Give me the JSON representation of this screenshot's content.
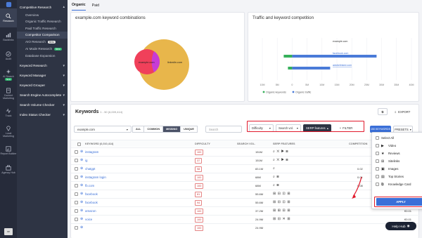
{
  "rail": {
    "items": [
      {
        "icon": "search-icon",
        "label": "Research",
        "active": true
      },
      {
        "icon": "chart-icon",
        "label": "Backlinks"
      },
      {
        "icon": "check-icon",
        "label": "Audit"
      },
      {
        "icon": "ai-icon",
        "label": "AI Search",
        "badge": "New"
      },
      {
        "icon": "doc-icon",
        "label": "Content Marketing"
      },
      {
        "icon": "pulse-icon",
        "label": "Track"
      },
      {
        "icon": "pin-icon",
        "label": "Local Marketing"
      },
      {
        "icon": "report-icon",
        "label": "Report Builder"
      },
      {
        "icon": "agency-icon",
        "label": "Agency Hub"
      }
    ]
  },
  "sidebar": {
    "sections": [
      {
        "label": "Competitive Research",
        "expanded": true,
        "subs": [
          {
            "label": "Overview"
          },
          {
            "label": "Organic Traffic Research"
          },
          {
            "label": "Paid Traffic Research"
          },
          {
            "label": "Competitor Comparison",
            "active": true
          },
          {
            "label": "AIO Research",
            "tag": "Beta"
          },
          {
            "label": "AI Mode Research",
            "tag": "New"
          },
          {
            "label": "Database Expansion"
          }
        ]
      },
      {
        "label": "Keyword Research"
      },
      {
        "label": "Keyword Manager"
      },
      {
        "label": "Keyword Grouper"
      },
      {
        "label": "Search Engine Autocomplete"
      },
      {
        "label": "Search Volume Checker"
      },
      {
        "label": "Index Status Checker"
      }
    ]
  },
  "tabs": [
    {
      "label": "Organic",
      "active": true
    },
    {
      "label": "Paid"
    }
  ],
  "venn": {
    "title": "example.com keyword combinations",
    "labels": {
      "left": "example.com",
      "right": "linkedin.com"
    },
    "colors": {
      "left": "#f0405a",
      "right": "#e8b64b",
      "overlap": "#c73bd6"
    }
  },
  "traffic": {
    "title": "Traffic and keyword competition",
    "rows": [
      {
        "label": "example.com"
      },
      {
        "label": "facebook.com",
        "link": true
      },
      {
        "label": "adobelinked.com",
        "link": true
      }
    ],
    "ticks": [
      "10M",
      "5M",
      "0",
      "5M",
      "10M",
      "15M",
      "20M",
      "25M",
      "30M",
      "35M",
      "40M"
    ],
    "legend": [
      "Organic keywords",
      "Organic traffic"
    ],
    "colors": {
      "organic": "#35b05a",
      "traffic": "#4a7bd8"
    }
  },
  "keywords": {
    "title": "Keywords",
    "count": "1 - 50 (6,009,414)",
    "export": "EXPORT",
    "domain_select": "example.com",
    "filter_tabs": [
      "ALL",
      "COMMON",
      "MISSING",
      "UNIQUE"
    ],
    "active_filter": "MISSING",
    "search_placeholder": "Search",
    "filters": [
      "Difficulty",
      "Search vol.",
      "SERP features"
    ],
    "filter_btn": "FILTER",
    "keywords_btn": "150 KEYWORDS",
    "presets": "PRESETS",
    "columns": [
      "KEYWORD (6,010,414)",
      "DIFFICULTY",
      "SEARCH VOL.",
      "SERP FEATURES",
      "COMPETITION",
      "CPC"
    ],
    "rows": [
      {
        "kw": "instagram",
        "diff": "100",
        "vol": "151M",
        "serp": "⌕ ✕ ▶ ⊞",
        "comp": "",
        "cpc": "€0.01"
      },
      {
        "kw": "ig",
        "diff": "37",
        "vol": "151M",
        "serp": "⌕ ✕ ▶ ⊞",
        "comp": "",
        "cpc": "€0.01"
      },
      {
        "kw": "chatgpt",
        "diff": "98",
        "vol": "83.1M",
        "serp": "⌕",
        "comp": "0.02",
        "cpc": "€0.01"
      },
      {
        "kw": "instagram login",
        "diff": "100",
        "vol": "68M",
        "serp": "⌕ ⊞",
        "comp": "0.01",
        "cpc": "€0.01"
      },
      {
        "kw": "fb.com",
        "diff": "100",
        "vol": "68M",
        "serp": "⌕ ⊞",
        "comp": "0.08",
        "cpc": "€0.01"
      },
      {
        "kw": "facebook",
        "diff": "81",
        "vol": "55.6M",
        "serp": "⊞ ⊟ ⊡ ⊞",
        "comp": "",
        "cpc": "€0.28"
      },
      {
        "kw": "facebook",
        "diff": "94",
        "vol": "55.6M",
        "serp": "⊞ ⊟ ⊡ ⊞",
        "comp": "",
        "cpc": "€0.1"
      },
      {
        "kw": "amazon",
        "diff": "100",
        "vol": "37.2M",
        "serp": "⊞ ⊞ ⊟ ⊞",
        "comp": "",
        "cpc": "€0.01"
      },
      {
        "kw": "voice",
        "diff": "100",
        "vol": "24.9M",
        "serp": "⊞ ⊟ ✕ ⊞",
        "comp": "",
        "cpc": "€0.01"
      },
      {
        "kw": "",
        "diff": "100",
        "vol": "24.9M",
        "serp": "",
        "comp": "",
        "cpc": ""
      }
    ]
  },
  "serp_dropdown": {
    "items": [
      {
        "icon": "",
        "label": "Select All"
      },
      {
        "icon": "▶",
        "label": "Video"
      },
      {
        "icon": "★",
        "label": "Reviews"
      },
      {
        "icon": "⊞",
        "label": "Sitelinks"
      },
      {
        "icon": "▣",
        "label": "Images"
      },
      {
        "icon": "▤",
        "label": "Top Stories"
      },
      {
        "icon": "⧉",
        "label": "Knowledge Card"
      }
    ],
    "apply": "APPLY"
  },
  "help": "Help Hub"
}
